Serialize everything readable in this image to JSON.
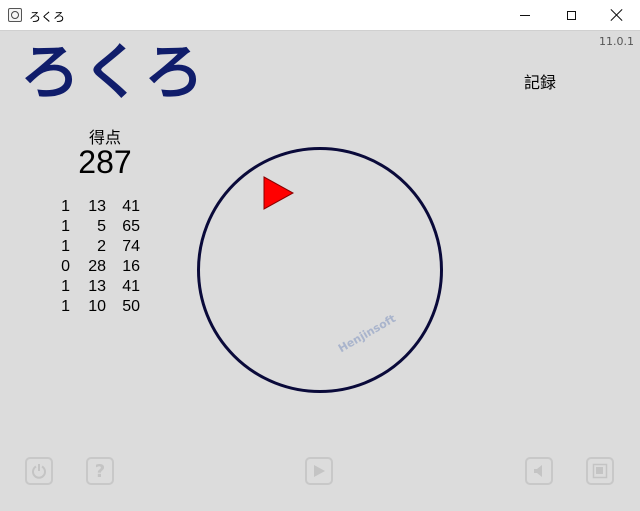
{
  "window": {
    "title": "ろくろ",
    "icon": "app-icon"
  },
  "version": "11.0.1",
  "logo": "ろくろ",
  "records_label": "記録",
  "score": {
    "label": "得点",
    "value": "287"
  },
  "history": [
    [
      "1",
      "13",
      "41"
    ],
    [
      "1",
      "5",
      "65"
    ],
    [
      "1",
      "2",
      "74"
    ],
    [
      "0",
      "28",
      "16"
    ],
    [
      "1",
      "13",
      "41"
    ],
    [
      "1",
      "10",
      "50"
    ]
  ],
  "watermark": "Henjinsoft",
  "controls": {
    "power": "power-icon",
    "help": "?",
    "play": "play-icon",
    "sound": "speaker-icon",
    "window": "window-icon"
  },
  "colors": {
    "logo": "#101d6b",
    "ring": "#0a0a3a",
    "pointer": "#ff0000",
    "background": "#dcdcdc"
  }
}
